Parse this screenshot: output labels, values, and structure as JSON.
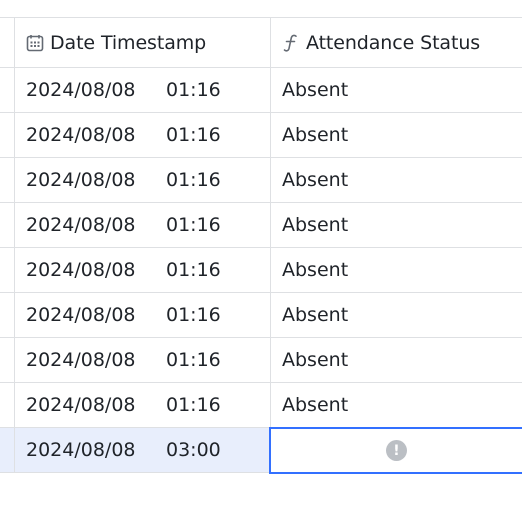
{
  "columns": {
    "date": {
      "label": "Date Timestamp",
      "icon": "calendar-icon"
    },
    "status": {
      "label": "Attendance Status",
      "icon": "formula-icon"
    }
  },
  "rows": [
    {
      "date": "2024/08/08",
      "time": "01:16",
      "status": "Absent"
    },
    {
      "date": "2024/08/08",
      "time": "01:16",
      "status": "Absent"
    },
    {
      "date": "2024/08/08",
      "time": "01:16",
      "status": "Absent"
    },
    {
      "date": "2024/08/08",
      "time": "01:16",
      "status": "Absent"
    },
    {
      "date": "2024/08/08",
      "time": "01:16",
      "status": "Absent"
    },
    {
      "date": "2024/08/08",
      "time": "01:16",
      "status": "Absent"
    },
    {
      "date": "2024/08/08",
      "time": "01:16",
      "status": "Absent"
    },
    {
      "date": "2024/08/08",
      "time": "01:16",
      "status": "Absent"
    },
    {
      "date": "2024/08/08",
      "time": "03:00",
      "status": "",
      "error_icon": "!"
    }
  ],
  "colors": {
    "accent": "#3370ff",
    "selected_row": "#e8eefc",
    "border": "#dee0e3",
    "error_icon": "#bbbfc4"
  }
}
